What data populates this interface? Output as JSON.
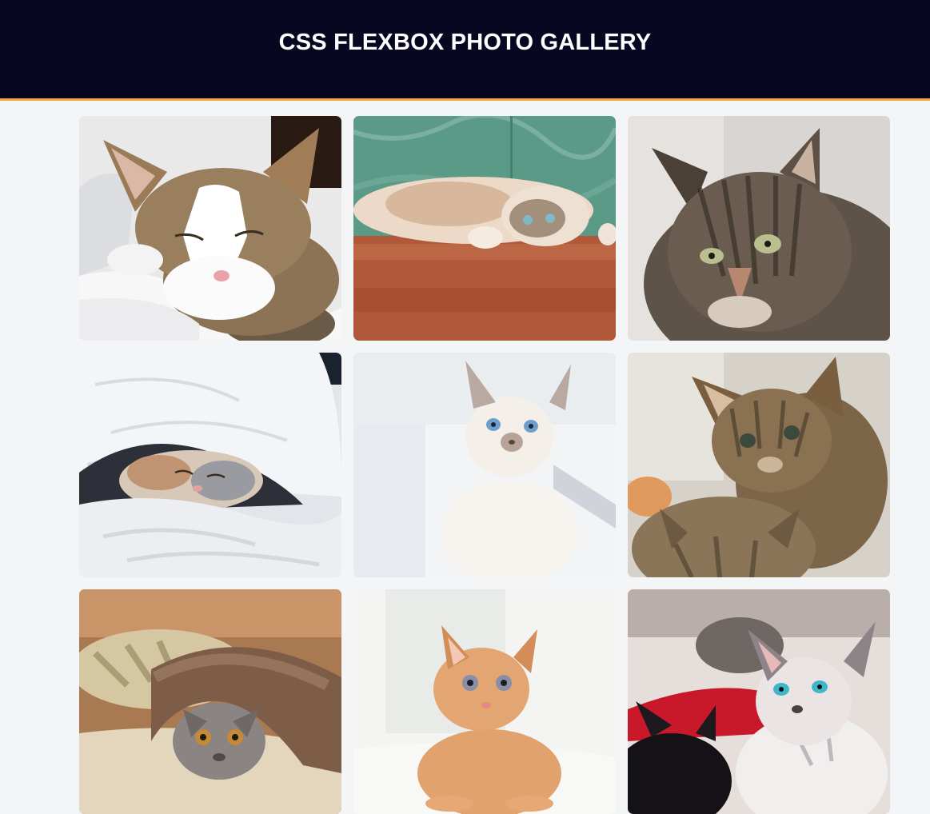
{
  "header": {
    "title": "CSS FLEXBOX PHOTO GALLERY",
    "accent_color": "#f3a43b",
    "background_color": "#080722"
  },
  "gallery": {
    "photos": [
      {
        "subject": "tabby-white cat sleeping on white blanket",
        "icon": "cat-photo"
      },
      {
        "subject": "cream cat lying upside down on wooden floor",
        "icon": "cat-photo"
      },
      {
        "subject": "grey tabby long-haired cat portrait",
        "icon": "cat-photo"
      },
      {
        "subject": "kitten sleeping under white duvet",
        "icon": "cat-photo"
      },
      {
        "subject": "white siamese kitten with blue eyes",
        "icon": "cat-photo"
      },
      {
        "subject": "two tabby kittens",
        "icon": "cat-photo"
      },
      {
        "subject": "grey kitten under brown fluffy blanket",
        "icon": "cat-photo"
      },
      {
        "subject": "orange kitten lying on white sofa",
        "icon": "cat-photo"
      },
      {
        "subject": "white and black kittens with blue eyes",
        "icon": "cat-photo"
      }
    ]
  }
}
